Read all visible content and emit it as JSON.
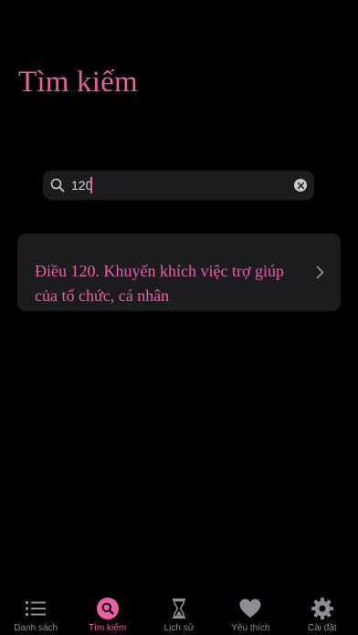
{
  "header": {
    "title": "Tìm kiếm"
  },
  "search": {
    "value": "120",
    "clear_icon": "clear-circle-icon",
    "search_icon": "magnifier-icon"
  },
  "results": [
    {
      "text": "Điều 120. Khuyến khích việc trợ giúp của tổ chức, cá nhân"
    }
  ],
  "tabs": [
    {
      "label": "Danh sách",
      "icon": "list-icon",
      "active": false
    },
    {
      "label": "Tìm kiếm",
      "icon": "search-icon",
      "active": true
    },
    {
      "label": "Lịch sử",
      "icon": "hourglass-icon",
      "active": false
    },
    {
      "label": "Yêu thích",
      "icon": "heart-icon",
      "active": false
    },
    {
      "label": "Cài đặt",
      "icon": "gear-icon",
      "active": false
    }
  ],
  "colors": {
    "accent": "#ec5fa5",
    "background": "#000000",
    "surface": "#1c1c1e",
    "inactive": "#8e8e93"
  }
}
